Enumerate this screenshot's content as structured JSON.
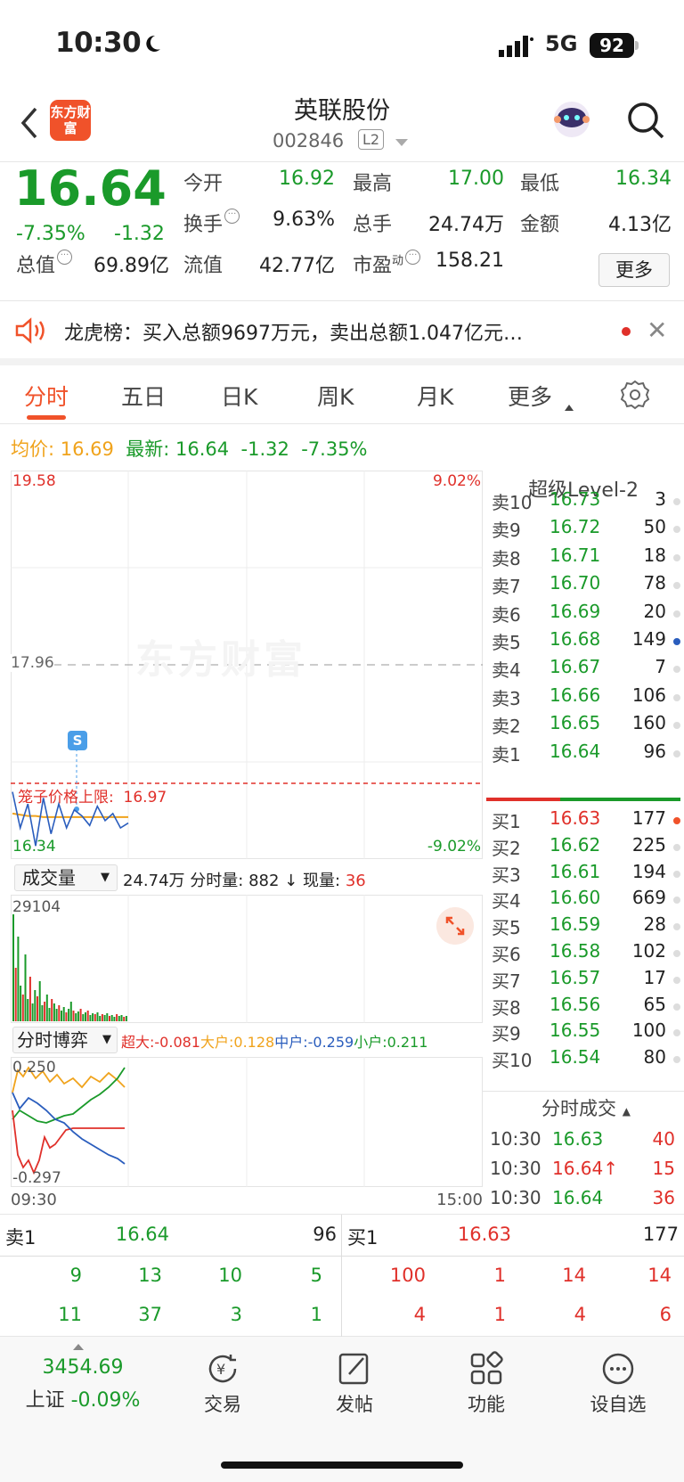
{
  "status": {
    "time": "10:30",
    "network": "5G",
    "battery": "92"
  },
  "nav": {
    "logo_text": "东方财富",
    "title": "英联股份",
    "code": "002846",
    "level": "L2"
  },
  "quote": {
    "price": "16.64",
    "pct": "-7.35%",
    "change": "-1.32",
    "open_label": "今开",
    "open": "16.92",
    "high_label": "最高",
    "high": "17.00",
    "low_label": "最低",
    "low": "16.34",
    "turnover_label": "换手",
    "turnover": "9.63%",
    "volume_label": "总手",
    "volume": "24.74万",
    "amount_label": "金额",
    "amount": "4.13亿",
    "mcap_label": "总值",
    "mcap": "69.89亿",
    "float_label": "流值",
    "float_cap": "42.77亿",
    "pe_label": "市盈",
    "pe_sup": "动",
    "pe": "158.21",
    "more_label": "更多"
  },
  "notice": {
    "text": "龙虎榜：买入总额9697万元，卖出总额1.047亿元…"
  },
  "tabs": [
    {
      "label": "分时"
    },
    {
      "label": "五日"
    },
    {
      "label": "日K"
    },
    {
      "label": "周K"
    },
    {
      "label": "月K"
    },
    {
      "label": "更多"
    }
  ],
  "avgline": {
    "avg_label": "均价:",
    "avg": "16.69",
    "latest_label": "最新:",
    "latest": "16.64",
    "chg": "-1.32",
    "pct": "-7.35%"
  },
  "chart": {
    "top_price": "19.58",
    "top_pct": "9.02%",
    "mid_price": "17.96",
    "bottom_price": "16.34",
    "bottom_pct": "-9.02%",
    "limit_label": "笼子价格上限:",
    "limit_value": "16.97",
    "watermark": "东方财富",
    "s_marker": "S"
  },
  "chart_data": {
    "type": "line",
    "ylim": [
      16.34,
      19.58
    ],
    "series": [
      {
        "name": "均价",
        "values": [
          16.72,
          16.71,
          16.7,
          16.7,
          16.69,
          16.69,
          16.69,
          16.69,
          16.69,
          16.69,
          16.69,
          16.69,
          16.69,
          16.69,
          16.69,
          16.69
        ]
      },
      {
        "name": "最新",
        "values": [
          16.9,
          16.6,
          16.8,
          16.45,
          16.85,
          16.55,
          16.8,
          16.6,
          16.75,
          16.7,
          16.62,
          16.78,
          16.66,
          16.72,
          16.6,
          16.64
        ]
      }
    ]
  },
  "volume": {
    "selector": "成交量",
    "total": "24.74万",
    "minute_label": "分时量:",
    "minute": "882",
    "arrow": "↓",
    "now_label": "现量:",
    "now": "36",
    "max": "29104"
  },
  "bohe": {
    "selector": "分时博弈",
    "big_label": "超大:",
    "big": "-0.081",
    "large_label": "大户:",
    "large": "0.128",
    "mid_label": "中户:",
    "mid": "-0.259",
    "small_label": "小户:",
    "small": "0.211",
    "top": "0.250",
    "bottom": "-0.297",
    "start_time": "09:30",
    "end_time": "15:00"
  },
  "level2": {
    "title": "超级Level-2",
    "asks": [
      {
        "name": "卖10",
        "price": "16.73",
        "vol": "3"
      },
      {
        "name": "卖9",
        "price": "16.72",
        "vol": "50"
      },
      {
        "name": "卖8",
        "price": "16.71",
        "vol": "18"
      },
      {
        "name": "卖7",
        "price": "16.70",
        "vol": "78"
      },
      {
        "name": "卖6",
        "price": "16.69",
        "vol": "20"
      },
      {
        "name": "卖5",
        "price": "16.68",
        "vol": "149"
      },
      {
        "name": "卖4",
        "price": "16.67",
        "vol": "7"
      },
      {
        "name": "卖3",
        "price": "16.66",
        "vol": "106"
      },
      {
        "name": "卖2",
        "price": "16.65",
        "vol": "160"
      },
      {
        "name": "卖1",
        "price": "16.64",
        "vol": "96"
      }
    ],
    "bids": [
      {
        "name": "买1",
        "price": "16.63",
        "vol": "177"
      },
      {
        "name": "买2",
        "price": "16.62",
        "vol": "225"
      },
      {
        "name": "买3",
        "price": "16.61",
        "vol": "194"
      },
      {
        "name": "买4",
        "price": "16.60",
        "vol": "669"
      },
      {
        "name": "买5",
        "price": "16.59",
        "vol": "28"
      },
      {
        "name": "买6",
        "price": "16.58",
        "vol": "102"
      },
      {
        "name": "买7",
        "price": "16.57",
        "vol": "17"
      },
      {
        "name": "买8",
        "price": "16.56",
        "vol": "65"
      },
      {
        "name": "买9",
        "price": "16.55",
        "vol": "100"
      },
      {
        "name": "买10",
        "price": "16.54",
        "vol": "80"
      }
    ],
    "ticks_title": "分时成交",
    "ticks": [
      {
        "time": "10:30",
        "price": "16.63",
        "vol": "40"
      },
      {
        "time": "10:30",
        "price": "16.64↑",
        "vol": "15"
      },
      {
        "time": "10:30",
        "price": "16.64",
        "vol": "36"
      }
    ]
  },
  "bottom_queue": {
    "ask_label": "卖1",
    "ask_price": "16.64",
    "ask_vol": "96",
    "bid_label": "买1",
    "bid_price": "16.63",
    "bid_vol": "177",
    "ask_rows": [
      [
        "9",
        "13",
        "10",
        "5"
      ],
      [
        "11",
        "37",
        "3",
        "1"
      ]
    ],
    "bid_rows": [
      [
        "100",
        "1",
        "14",
        "14"
      ],
      [
        "4",
        "1",
        "4",
        "6"
      ]
    ]
  },
  "tabbar": {
    "index_value": "3454.69",
    "index_name": "上证",
    "index_pct": "-0.09%",
    "items": [
      {
        "label": "交易"
      },
      {
        "label": "发帖"
      },
      {
        "label": "功能"
      },
      {
        "label": "设自选"
      }
    ]
  },
  "colors": {
    "up": "#e0302a",
    "down": "#1a9a2a",
    "accent": "#f0522a",
    "avg": "#f0a31c"
  }
}
